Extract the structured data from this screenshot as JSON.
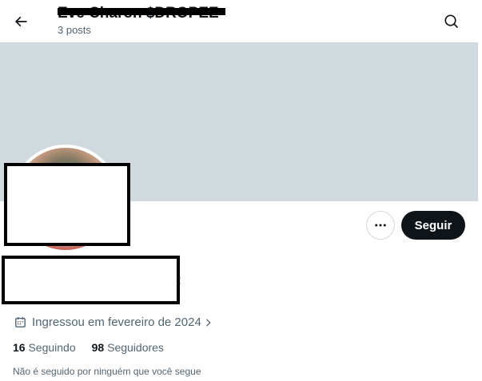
{
  "header": {
    "title": "Eve Charon $DROPEE",
    "posts": "3 posts"
  },
  "profile": {
    "name_tail": ":",
    "follow_label": "Seguir",
    "joined": "Ingressou em fevereiro de 2024",
    "following_count": "16",
    "following_label": "Seguindo",
    "followers_count": "98",
    "followers_label": "Seguidores",
    "not_followed": "Não é seguido por ninguém que você segue"
  },
  "icons": {
    "back": "arrow-left-icon",
    "search": "search-icon",
    "more": "more-horizontal-icon",
    "calendar": "calendar-icon",
    "chevron": "chevron-right-icon"
  },
  "colors": {
    "banner": "#cfd9de",
    "follow_button": "#0f1419",
    "secondary_text": "#536471"
  }
}
